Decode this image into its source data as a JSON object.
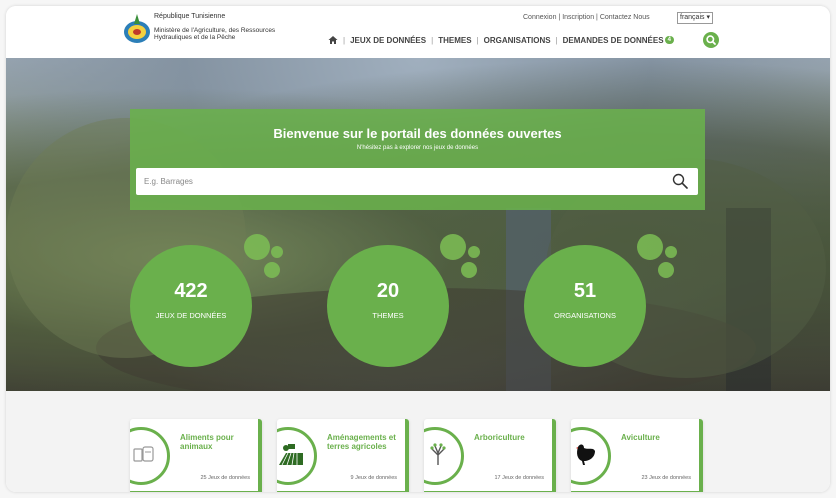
{
  "header": {
    "country": "République Tunisienne",
    "ministry": "Ministère de l'Agriculture, des Ressources Hydrauliques et de la Pêche",
    "top_links": [
      "Connexion",
      "Inscription",
      "Contactez Nous"
    ],
    "language": "français",
    "nav": [
      "JEUX DE DONNÉES",
      "THEMES",
      "ORGANISATIONS",
      "DEMANDES DE DONNÉES"
    ],
    "nav_badge": "4",
    "icons": [
      "home-icon",
      "search-icon"
    ]
  },
  "hero": {
    "title": "Bienvenue sur le portail des données ouvertes",
    "subtitle": "N'hésitez pas à explorer nos jeux de données",
    "search_placeholder": "E.g. Barrages"
  },
  "stats": [
    {
      "value": "422",
      "label": "JEUX DE DONNÉES"
    },
    {
      "value": "20",
      "label": "THEMES"
    },
    {
      "value": "51",
      "label": "ORGANISATIONS"
    }
  ],
  "themes": [
    {
      "title": "Aliments pour animaux",
      "count": "25 Jeux de données",
      "icon": "feed-icon"
    },
    {
      "title": "Aménagements et terres agricoles",
      "count": "9 Jeux de données",
      "icon": "tractor-field-icon"
    },
    {
      "title": "Arboriculture",
      "count": "17 Jeux de données",
      "icon": "tree-icon"
    },
    {
      "title": "Aviculture",
      "count": "23 Jeux de données",
      "icon": "rooster-icon"
    }
  ],
  "colors": {
    "accent": "#6ab04c",
    "white": "#ffffff"
  }
}
